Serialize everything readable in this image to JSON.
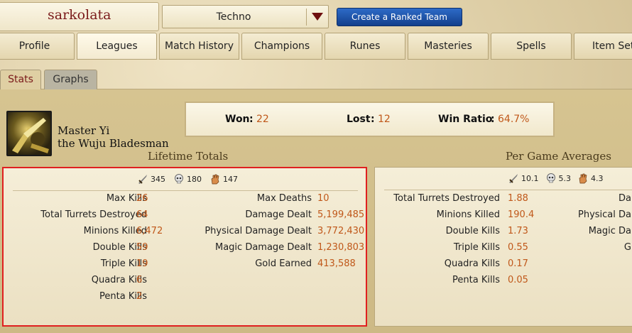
{
  "summoner": {
    "name": "sarkolata"
  },
  "queue_select": {
    "value": "Techno"
  },
  "ranked_button": {
    "label": "Create a Ranked Team"
  },
  "main_tabs": [
    {
      "label": "Profile"
    },
    {
      "label": "Leagues"
    },
    {
      "label": "Match History"
    },
    {
      "label": "Champions"
    },
    {
      "label": "Runes"
    },
    {
      "label": "Masteries"
    },
    {
      "label": "Spells"
    },
    {
      "label": "Item Sets"
    }
  ],
  "sub_tabs": [
    {
      "label": "Stats"
    },
    {
      "label": "Graphs"
    }
  ],
  "champion": {
    "name": "Master Yi",
    "title": "the Wuju Bladesman"
  },
  "record": {
    "won_label": "Won",
    "won": "22",
    "lost_label": "Lost",
    "lost": "12",
    "ratio_label": "Win Ratio",
    "ratio": "64.7%"
  },
  "lifetime": {
    "title": "Lifetime Totals",
    "kills": "345",
    "deaths": "180",
    "assists": "147",
    "left": [
      {
        "label": "Max Kills",
        "value": "26"
      },
      {
        "label": "Total Turrets Destroyed",
        "value": "64"
      },
      {
        "label": "Minions Killed",
        "value": "6,472"
      },
      {
        "label": "Double Kills",
        "value": "59"
      },
      {
        "label": "Triple Kills",
        "value": "19"
      },
      {
        "label": "Quadra Kills",
        "value": "6"
      },
      {
        "label": "Penta Kills",
        "value": "2"
      }
    ],
    "right": [
      {
        "label": "Max Deaths",
        "value": "10"
      },
      {
        "label": "Damage Dealt",
        "value": "5,199,485"
      },
      {
        "label": "Physical Damage Dealt",
        "value": "3,772,430"
      },
      {
        "label": "Magic Damage Dealt",
        "value": "1,230,803"
      },
      {
        "label": "Gold Earned",
        "value": "413,588"
      }
    ]
  },
  "averages": {
    "title": "Per Game Averages",
    "kills": "10.1",
    "deaths": "5.3",
    "assists": "4.3",
    "left": [
      {
        "label": "Total Turrets Destroyed",
        "value": "1.88"
      },
      {
        "label": "Minions Killed",
        "value": "190.4"
      },
      {
        "label": "Double Kills",
        "value": "1.73"
      },
      {
        "label": "Triple Kills",
        "value": "0.55"
      },
      {
        "label": "Quadra Kills",
        "value": "0.17"
      },
      {
        "label": "Penta Kills",
        "value": "0.05"
      }
    ],
    "right_partial": [
      {
        "label": "Da"
      },
      {
        "label": "Physical Da"
      },
      {
        "label": "Magic Da"
      },
      {
        "label": "G"
      }
    ]
  },
  "icons": {
    "kills": "sword-icon",
    "deaths": "skull-icon",
    "assists": "hand-icon"
  },
  "colors": {
    "accent_value": "#c0581a",
    "summoner_name": "#7a1a1a",
    "highlight_border": "#e02020",
    "ranked_button": "#1a4ea0"
  }
}
